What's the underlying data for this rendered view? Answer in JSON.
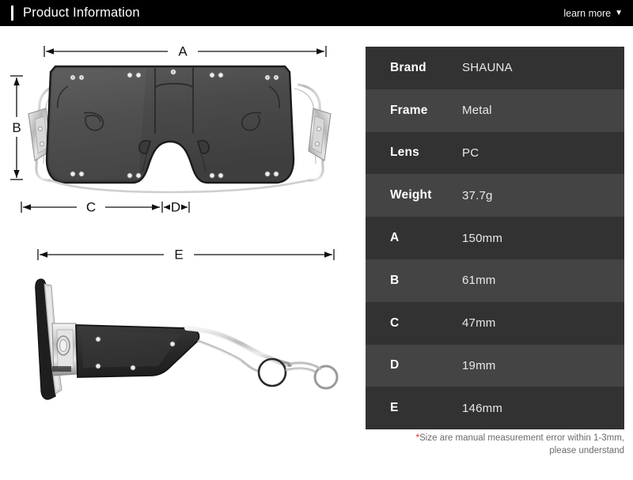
{
  "header": {
    "title": "Product Information",
    "learn_more_label": "learn more",
    "caret_icon": "chevron-down-icon",
    "caret_glyph": "▼",
    "background": "#000000",
    "text_color": "#ffffff"
  },
  "diagrams": {
    "front_view": {
      "name": "sunglasses-front-view",
      "dimension_labels": {
        "A": "A",
        "B": "B",
        "C": "C",
        "D": "D"
      }
    },
    "side_view": {
      "name": "sunglasses-side-view",
      "dimension_labels": {
        "E": "E"
      }
    }
  },
  "spec_table": {
    "rows": [
      {
        "key": "Brand",
        "value": "SHAUNA",
        "shade": "dark"
      },
      {
        "key": "Frame",
        "value": "Metal",
        "shade": "light"
      },
      {
        "key": "Lens",
        "value": "PC",
        "shade": "dark"
      },
      {
        "key": "Weight",
        "value": "37.7g",
        "shade": "light"
      },
      {
        "key": "A",
        "value": "150mm",
        "shade": "dark"
      },
      {
        "key": "B",
        "value": "61mm",
        "shade": "light"
      },
      {
        "key": "C",
        "value": "47mm",
        "shade": "dark"
      },
      {
        "key": "D",
        "value": "19mm",
        "shade": "light"
      },
      {
        "key": "E",
        "value": "146mm",
        "shade": "dark"
      }
    ],
    "row_color_dark": "#323232",
    "row_color_light": "#444444"
  },
  "footnote": {
    "asterisk": "*",
    "line1": "Size are manual measurement error within 1-3mm,",
    "line2": "please understand",
    "asterisk_color": "#e02020",
    "text_color": "#6b6b6b"
  }
}
